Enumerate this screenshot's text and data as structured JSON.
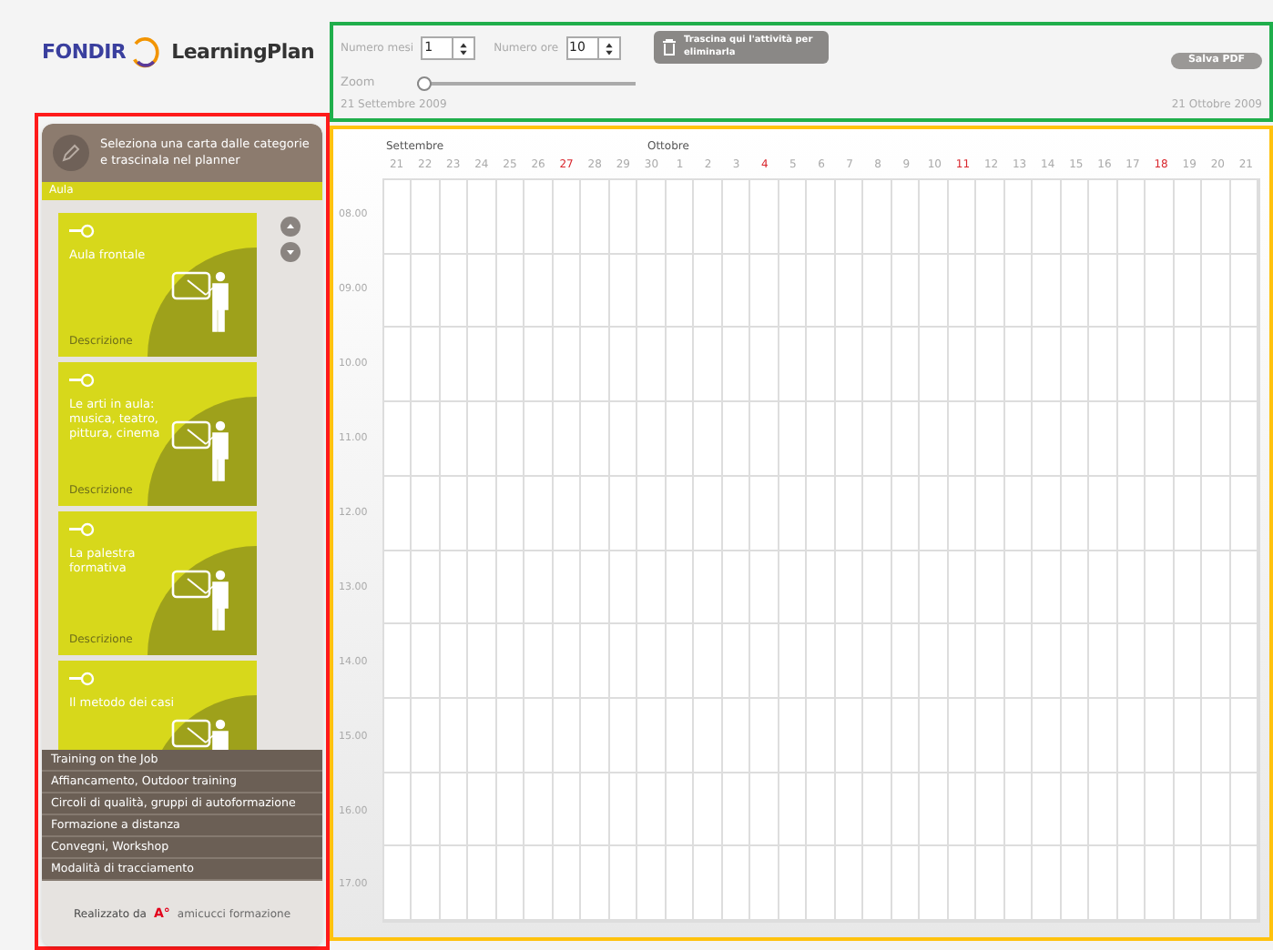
{
  "logo": {
    "brand": "FONDIR",
    "product": "LearningPlan"
  },
  "library": {
    "instruction": "Seleziona una carta dalle categorie e trascinala nel planner",
    "category": "Aula",
    "cards": [
      {
        "title": "Aula frontale",
        "description": "Descrizione"
      },
      {
        "title": "Le arti in aula: musica, teatro, pittura, cinema",
        "description": "Descrizione"
      },
      {
        "title": "La palestra formativa",
        "description": "Descrizione"
      },
      {
        "title": "Il metodo dei casi"
      }
    ],
    "other_categories": [
      "Training on the Job",
      "Affiancamento, Outdoor training",
      "Circoli di qualità, gruppi di autoformazione",
      "Formazione a distanza",
      "Convegni, Workshop",
      "Modalità di tracciamento"
    ],
    "credit": {
      "label": "Realizzato da",
      "mark": "A°",
      "company": "amicucci formazione"
    }
  },
  "toolbar": {
    "months": {
      "label": "Numero mesi",
      "value": "1"
    },
    "hours": {
      "label": "Numero ore",
      "value": "10"
    },
    "zoom": {
      "label": "Zoom",
      "level": 0
    },
    "trash": "Trascina qui l'attività per eliminarla",
    "save": "Salva PDF",
    "start_date": "21 Settembre 2009",
    "end_date": "21 Ottobre 2009"
  },
  "planner": {
    "months": [
      {
        "name": "Settembre",
        "days": [
          {
            "day": "21",
            "holiday": false
          },
          {
            "day": "22",
            "holiday": false
          },
          {
            "day": "23",
            "holiday": false
          },
          {
            "day": "24",
            "holiday": false
          },
          {
            "day": "25",
            "holiday": false
          },
          {
            "day": "26",
            "holiday": false
          },
          {
            "day": "27",
            "holiday": true
          },
          {
            "day": "28",
            "holiday": false
          },
          {
            "day": "29",
            "holiday": false
          },
          {
            "day": "30",
            "holiday": false
          }
        ]
      },
      {
        "name": "Ottobre",
        "days": [
          {
            "day": "1",
            "holiday": false
          },
          {
            "day": "2",
            "holiday": false
          },
          {
            "day": "3",
            "holiday": false
          },
          {
            "day": "4",
            "holiday": true
          },
          {
            "day": "5",
            "holiday": false
          },
          {
            "day": "6",
            "holiday": false
          },
          {
            "day": "7",
            "holiday": false
          },
          {
            "day": "8",
            "holiday": false
          },
          {
            "day": "9",
            "holiday": false
          },
          {
            "day": "10",
            "holiday": false
          },
          {
            "day": "11",
            "holiday": true
          },
          {
            "day": "12",
            "holiday": false
          },
          {
            "day": "13",
            "holiday": false
          },
          {
            "day": "14",
            "holiday": false
          },
          {
            "day": "15",
            "holiday": false
          },
          {
            "day": "16",
            "holiday": false
          },
          {
            "day": "17",
            "holiday": false
          },
          {
            "day": "18",
            "holiday": true
          },
          {
            "day": "19",
            "holiday": false
          },
          {
            "day": "20",
            "holiday": false
          },
          {
            "day": "21",
            "holiday": false
          }
        ]
      }
    ],
    "hours": [
      "08.00",
      "09.00",
      "10.00",
      "11.00",
      "12.00",
      "13.00",
      "14.00",
      "15.00",
      "16.00",
      "17.00"
    ]
  }
}
